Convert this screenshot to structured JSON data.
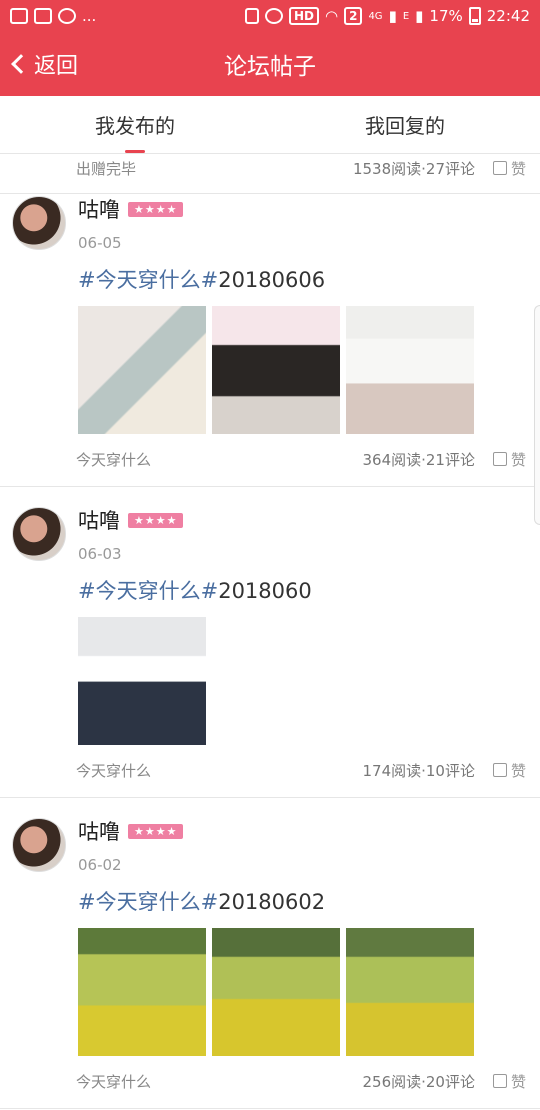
{
  "status_bar": {
    "left_text": "...",
    "hd": "HD",
    "sim": "2",
    "net": "4G",
    "e": "E",
    "battery": "17%",
    "time": "22:42"
  },
  "nav": {
    "back_label": "返回",
    "title": "论坛帖子"
  },
  "tabs": [
    {
      "label": "我发布的"
    },
    {
      "label": "我回复的"
    }
  ],
  "top_partial": {
    "category": "出赠完毕",
    "stats": "1538阅读·27评论",
    "like_label": "赞"
  },
  "posts": [
    {
      "name": "咕噜",
      "badge": "★★★★",
      "date": "06-05",
      "tag": "#今天穿什么#",
      "title_suffix": "20180606",
      "category": "今天穿什么",
      "stats": "364阅读·21评论",
      "like_label": "赞"
    },
    {
      "name": "咕噜",
      "badge": "★★★★",
      "date": "06-03",
      "tag": "#今天穿什么#",
      "title_suffix": "2018060",
      "category": "今天穿什么",
      "stats": "174阅读·10评论",
      "like_label": "赞"
    },
    {
      "name": "咕噜",
      "badge": "★★★★",
      "date": "06-02",
      "tag": "#今天穿什么#",
      "title_suffix": "20180602",
      "category": "今天穿什么",
      "stats": "256阅读·20评论",
      "like_label": "赞"
    }
  ],
  "colors": {
    "brand": "#e8434f",
    "badge": "#ef7fa2",
    "tag": "#4a6ea0"
  }
}
